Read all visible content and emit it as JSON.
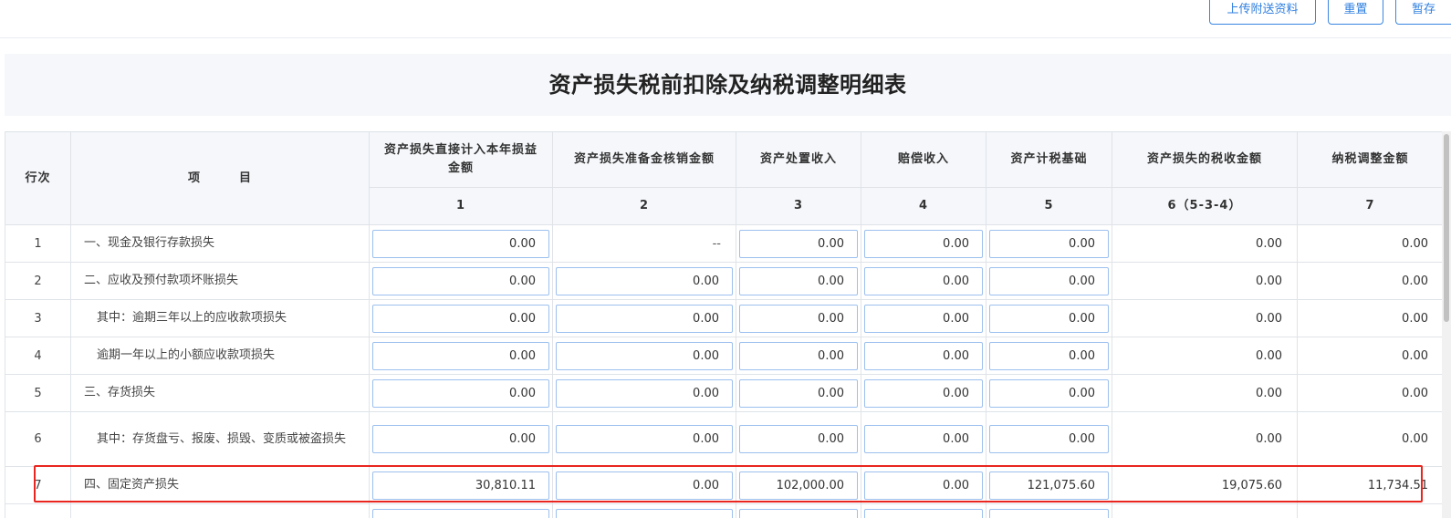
{
  "toolbar": {
    "upload_label": "上传附送资料",
    "reset_label": "重置",
    "save_label": "暂存"
  },
  "page_title": "资产损失税前扣除及纳税调整明细表",
  "table": {
    "headers": {
      "row_no": "行次",
      "item": "项　　　目",
      "col1": "资产损失直接计入本年损益金额",
      "col2": "资产损失准备金核销金额",
      "col3": "资产处置收入",
      "col4": "赔偿收入",
      "col5": "资产计税基础",
      "col6": "资产损失的税收金额",
      "col7": "纳税调整金额"
    },
    "col_numbers": [
      "1",
      "2",
      "3",
      "4",
      "5",
      "6（5-3-4）",
      "7"
    ],
    "rows": [
      {
        "no": "1",
        "item": "一、现金及银行存款损失",
        "c1": "0.00",
        "c2": "--",
        "c3": "0.00",
        "c4": "0.00",
        "c5": "0.00",
        "c6": "0.00",
        "c7": "0.00"
      },
      {
        "no": "2",
        "item": "二、应收及预付款项坏账损失",
        "c1": "0.00",
        "c2": "0.00",
        "c3": "0.00",
        "c4": "0.00",
        "c5": "0.00",
        "c6": "0.00",
        "c7": "0.00"
      },
      {
        "no": "3",
        "item": "其中：逾期三年以上的应收款项损失",
        "c1": "0.00",
        "c2": "0.00",
        "c3": "0.00",
        "c4": "0.00",
        "c5": "0.00",
        "c6": "0.00",
        "c7": "0.00"
      },
      {
        "no": "4",
        "item": "逾期一年以上的小额应收款项损失",
        "c1": "0.00",
        "c2": "0.00",
        "c3": "0.00",
        "c4": "0.00",
        "c5": "0.00",
        "c6": "0.00",
        "c7": "0.00"
      },
      {
        "no": "5",
        "item": "三、存货损失",
        "c1": "0.00",
        "c2": "0.00",
        "c3": "0.00",
        "c4": "0.00",
        "c5": "0.00",
        "c6": "0.00",
        "c7": "0.00"
      },
      {
        "no": "6",
        "item": "其中：存货盘亏、报废、损毁、变质或被盗损失",
        "c1": "0.00",
        "c2": "0.00",
        "c3": "0.00",
        "c4": "0.00",
        "c5": "0.00",
        "c6": "0.00",
        "c7": "0.00"
      },
      {
        "no": "7",
        "item": "四、固定资产损失",
        "c1": "30,810.11",
        "c2": "0.00",
        "c3": "102,000.00",
        "c4": "0.00",
        "c5": "121,075.60",
        "c6": "19,075.60",
        "c7": "11,734.51"
      }
    ]
  },
  "highlight_color": "#e8261f",
  "accent_color": "#2f7fe0"
}
